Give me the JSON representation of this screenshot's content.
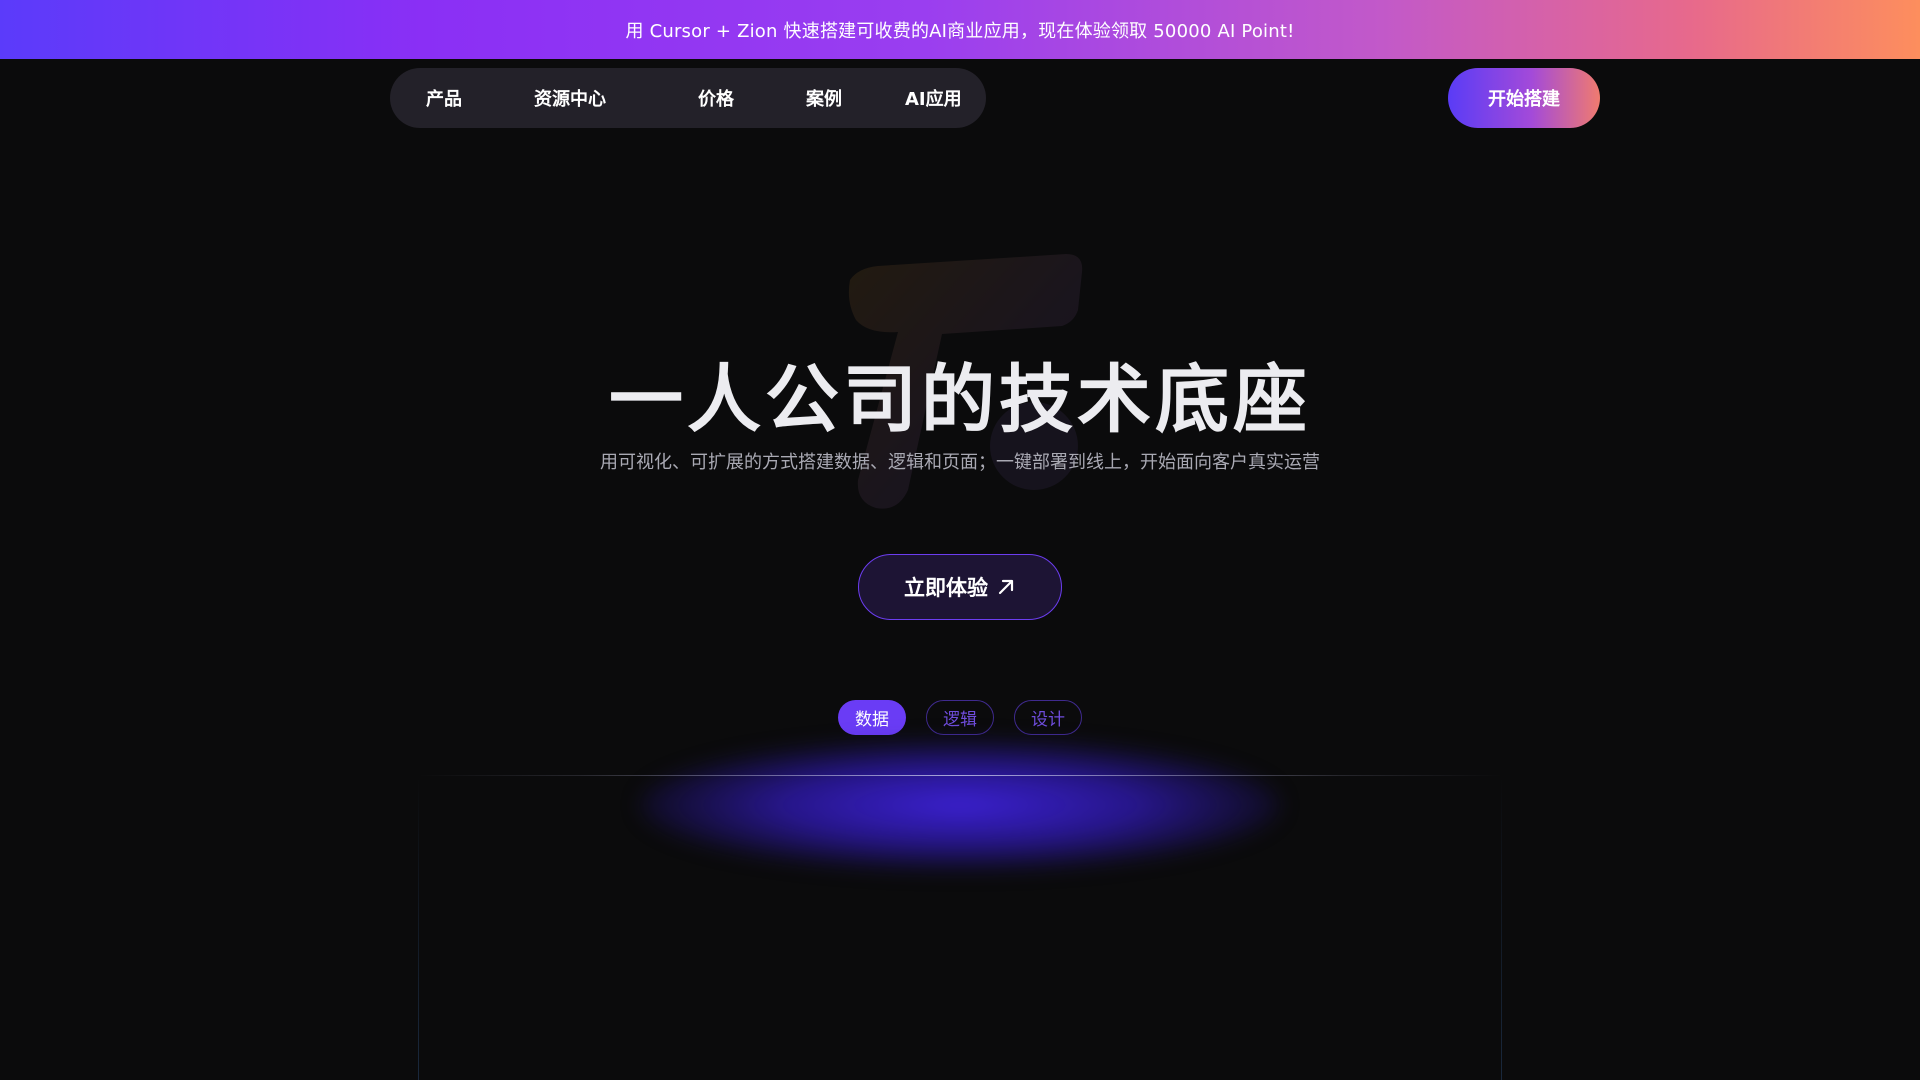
{
  "promo": {
    "text": "用 Cursor + Zion 快速搭建可收费的AI商业应用，现在体验领取 50000 AI Point!"
  },
  "nav": {
    "items": [
      {
        "label": "产品"
      },
      {
        "label": "资源中心"
      },
      {
        "label": "价格"
      },
      {
        "label": "案例"
      },
      {
        "label": "AI应用"
      }
    ]
  },
  "cta_top": {
    "label": "开始搭建"
  },
  "hero": {
    "title": "一人公司的技术底座",
    "subtitle": "用可视化、可扩展的方式搭建数据、逻辑和页面；一键部署到线上，开始面向客户真实运营",
    "button_label": "立即体验",
    "button_icon": "arrow-up-right-icon"
  },
  "tabs": [
    {
      "label": "数据",
      "active": true
    },
    {
      "label": "逻辑",
      "active": false
    },
    {
      "label": "设计",
      "active": false
    }
  ],
  "colors": {
    "accent": "#6a3cf5",
    "background": "#0b0b0c"
  }
}
